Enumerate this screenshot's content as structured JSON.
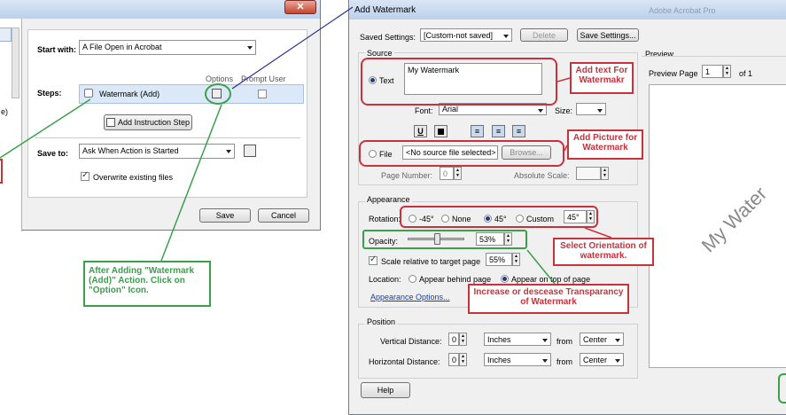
{
  "left_dialog": {
    "start_with_label": "Start with:",
    "start_with_value": "A File Open in Acrobat",
    "options_header": "Options",
    "prompt_user_header": "Prompt User",
    "steps_label": "Steps:",
    "step_name": "Watermark (Add)",
    "add_step_button": "Add Instruction Step",
    "save_to_label": "Save to:",
    "save_to_value": "Ask When Action is Started",
    "overwrite_label": "Overwrite existing files",
    "save_button": "Save",
    "cancel_button": "Cancel",
    "edge_text": "e)"
  },
  "watermark_dialog": {
    "title": "Add Watermark",
    "saved_settings_label": "Saved Settings:",
    "saved_settings_value": "[Custom-not saved]",
    "delete_button": "Delete",
    "save_settings_button": "Save Settings...",
    "source_header": "Source",
    "text_option": "Text",
    "text_value": "My Watermark",
    "font_label": "Font:",
    "font_value": "Arial",
    "size_label": "Size:",
    "underline_glyph": "U",
    "align_glyph": "≡",
    "file_option": "File",
    "file_value": "<No source file selected>",
    "browse_button": "Browse...",
    "page_number_label": "Page Number:",
    "page_number_value": "0",
    "absolute_scale_label": "Absolute Scale:",
    "appearance_header": "Appearance",
    "rotation_label": "Rotation:",
    "rot_neg45": "-45°",
    "rot_none": "None",
    "rot_45": "45°",
    "rot_custom": "Custom",
    "rot_custom_value": "45°",
    "opacity_label": "Opacity:",
    "opacity_value": "53%",
    "opacity_level": 0.53,
    "scale_label": "Scale relative to target page",
    "scale_value": "55%",
    "location_label": "Location:",
    "behind_option": "Appear behind page",
    "on_top_option": "Appear on top of page",
    "appearance_options_link": "Appearance Options...",
    "position_header": "Position",
    "vertical_label": "Vertical Distance:",
    "vertical_value": "0",
    "vertical_unit": "Inches",
    "vertical_from_label": "from",
    "vertical_from_value": "Center",
    "horizontal_label": "Horizontal Distance:",
    "horizontal_value": "0",
    "horizontal_unit": "Inches",
    "horizontal_from_label": "from",
    "horizontal_from_value": "Center",
    "help_button": "Help",
    "preview_header": "Preview",
    "preview_page_label": "Preview Page",
    "preview_page_value": "1",
    "preview_of": "of 1",
    "preview_watermark_text": "My Water",
    "background_tab_text": "Adobe Acrobat Pro"
  },
  "annotations": {
    "add_text": "Add text For Watermakr",
    "add_picture": "Add Picture for Watermark",
    "orientation": "Select Orientation of watermark.",
    "transparency": "Increase or descease Transparancy of Watermark",
    "after_adding": "After Adding \"Watermark (Add)\" Action. Click on \"Option\" Icon."
  },
  "colors": {
    "annotation_red": "#c8323c",
    "annotation_green": "#3aa04a",
    "connector_blue": "#2b2f8c"
  }
}
